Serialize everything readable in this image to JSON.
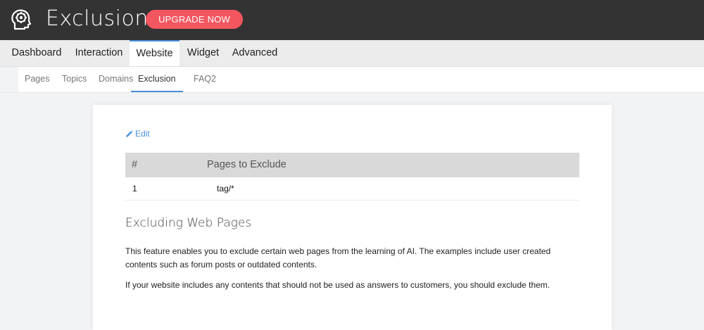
{
  "header": {
    "title": "Exclusion",
    "upgrade_label": "UPGRADE NOW",
    "logo_icon": "brain-head-icon",
    "accent_color": "#f2565f",
    "bar_color": "#333333"
  },
  "main_nav": {
    "tabs": [
      {
        "label": "Dashboard",
        "active": false
      },
      {
        "label": "Interaction",
        "active": false
      },
      {
        "label": "Website",
        "active": true
      },
      {
        "label": "Widget",
        "active": false
      },
      {
        "label": "Advanced",
        "active": false
      }
    ]
  },
  "sub_nav": {
    "items": [
      {
        "label": "Pages",
        "active": false
      },
      {
        "label": "Topics",
        "active": false
      },
      {
        "label": "Domains",
        "active": false
      },
      {
        "label": "Exclusion",
        "active": true
      },
      {
        "label": "FAQ2",
        "active": false
      }
    ]
  },
  "content": {
    "edit_label": "Edit",
    "edit_icon": "pencil-icon",
    "table": {
      "headers": [
        "#",
        "Pages to Exclude"
      ],
      "rows": [
        {
          "num": "1",
          "page": "tag/*"
        }
      ]
    },
    "section_title": "Excluding Web Pages",
    "paragraph_1": "This feature enables you to exclude certain web pages from the learning of AI. The examples include user created contents such as forum posts or outdated contents.",
    "paragraph_2": "If your website includes any contents that should not be used as answers to customers, you should exclude them."
  }
}
